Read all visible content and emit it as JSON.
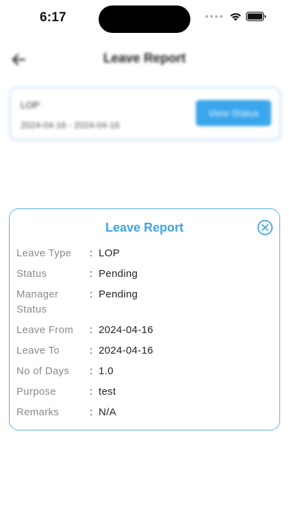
{
  "status_bar": {
    "time": "6:17",
    "icons": [
      "cellular-signal-icon",
      "wifi-icon",
      "battery-icon"
    ]
  },
  "header": {
    "title": "Leave Report",
    "back_icon": "arrow-left-icon"
  },
  "leave_card": {
    "type": "LOP",
    "dates": "2024-04-16 - 2024-04-16",
    "button_label": "View Status"
  },
  "modal": {
    "title": "Leave Report",
    "close_icon": "close-circle-icon",
    "details": [
      {
        "label": "Leave Type",
        "value": "LOP"
      },
      {
        "label": "Status",
        "value": "Pending"
      },
      {
        "label": "Manager Status",
        "value": "Pending"
      },
      {
        "label": "Leave From",
        "value": "2024-04-16"
      },
      {
        "label": "Leave To",
        "value": "2024-04-16"
      },
      {
        "label": "No of Days",
        "value": "1.0"
      },
      {
        "label": "Purpose",
        "value": "test"
      },
      {
        "label": "Remarks",
        "value": "N/A"
      }
    ]
  },
  "colors": {
    "accent": "#3ea5e2",
    "button": "#3aa6ec",
    "label_gray": "#8a8a8a"
  }
}
